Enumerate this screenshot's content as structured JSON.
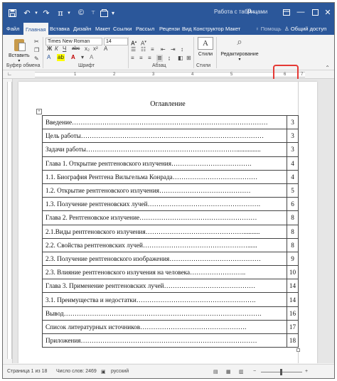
{
  "titlebar": {
    "context_title": "Работа с таблицами",
    "doc_name": "р...",
    "icons": [
      "save-icon",
      "undo-icon",
      "redo-icon",
      "pi-icon",
      "copyright-icon",
      "quick-access-icon"
    ]
  },
  "tabs": [
    {
      "label": "Файл"
    },
    {
      "label": "Главная"
    },
    {
      "label": "Вставка"
    },
    {
      "label": "Дизайн"
    },
    {
      "label": "Макет"
    },
    {
      "label": "Ссылки"
    },
    {
      "label": "Рассыл"
    },
    {
      "label": "Рецензи"
    },
    {
      "label": "Вид"
    },
    {
      "label": "Конструктор"
    },
    {
      "label": "Макет"
    }
  ],
  "help": {
    "label": "Помощь"
  },
  "share": {
    "label": "Общий доступ"
  },
  "ribbon": {
    "paste_label": "Вставить",
    "font_name": "Times New Roman",
    "font_size": "14",
    "styles_label": "Стили",
    "editing_label": "Редактирование",
    "groups": {
      "clipboard": "Буфер обмена",
      "font": "Шрифт",
      "paragraph": "Абзац",
      "styles": "Стили"
    },
    "format_buttons": [
      "Ж",
      "К",
      "Ч",
      "abc",
      "x₂",
      "x²"
    ]
  },
  "ruler": {
    "numbers": [
      "1",
      "2",
      "3",
      "4",
      "5",
      "6",
      "7"
    ]
  },
  "document": {
    "toc_title": "Оглавление",
    "rows": [
      {
        "text": "Введение………………………………………………………………………………",
        "page": "3"
      },
      {
        "text": " Цель работы…………………………………………………………………………",
        "page": "3"
      },
      {
        "text": "Задачи работы……………………………………………………………...............",
        "page": "3"
      },
      {
        "text": "Глава 1. Открытие рентгеновского излучения……………………………….",
        "page": "4"
      },
      {
        "text": "1.1. Биография Рентгена Вильгельма Конрада…………………………………",
        "page": "4"
      },
      {
        "text": "1.2. Открытие рентгеновского излучения……………………………………",
        "page": "5"
      },
      {
        "text": "1.3. Получение рентгеновских лучей…………………………………………….",
        "page": "6"
      },
      {
        "text": "Глава 2. Рентгеновское излучение………………………………………………",
        "page": "8"
      },
      {
        "text": "2.1.Виды рентгеновского излучения………………………………………..........",
        "page": "8"
      },
      {
        "text": "2.2. Свойства рентгеновских лучей…………………………………………......",
        "page": "8"
      },
      {
        "text": "2.3. Получение рентгеновского изображения……………………………………",
        "page": "9"
      },
      {
        "text": "2.3. Влияние рентгеновского излучения на человека……………………..",
        "page": "10"
      },
      {
        "text": "Глава 3. Применение рентгеновских лучей……………………………………",
        "page": "14"
      },
      {
        "text": "3.1. Преимущества и недостатки……………………………………………….",
        "page": "14"
      },
      {
        "text": "Вывод……………………………………………………………………………….",
        "page": "16"
      },
      {
        "text": "Список литературных источников………………………………………….",
        "page": "17"
      },
      {
        "text": "Приложения………………………………………………………………………",
        "page": "18"
      }
    ]
  },
  "statusbar": {
    "page": "Страница 1 из 18",
    "words": "Число слов: 2469",
    "language": "русский"
  },
  "colors": {
    "accent": "#2b579a",
    "highlight": "#e53935"
  }
}
